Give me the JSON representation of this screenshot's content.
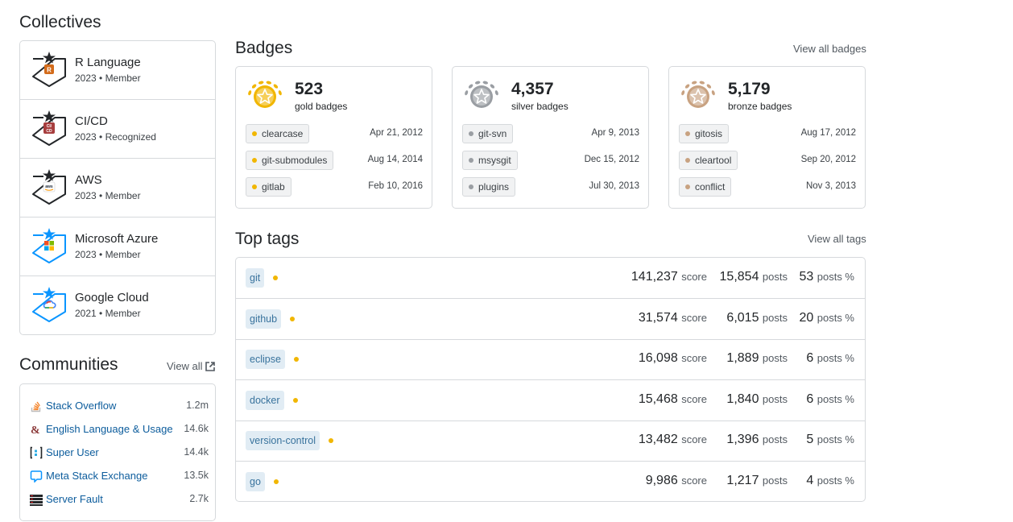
{
  "collectives": {
    "title": "Collectives",
    "items": [
      {
        "name": "R Language",
        "meta": "2023 • Member",
        "icon": "r-language-icon",
        "color": "#d36b1a"
      },
      {
        "name": "CI/CD",
        "meta": "2023 • Recognized",
        "icon": "cicd-icon",
        "color": "#a73e3e"
      },
      {
        "name": "AWS",
        "meta": "2023 • Member",
        "icon": "aws-icon",
        "color": "#232f3e"
      },
      {
        "name": "Microsoft Azure",
        "meta": "2023 • Member",
        "icon": "microsoft-azure-icon",
        "color": "#0078d4"
      },
      {
        "name": "Google Cloud",
        "meta": "2021 • Member",
        "icon": "google-cloud-icon",
        "color": "#4285f4"
      }
    ]
  },
  "communities": {
    "title": "Communities",
    "view_all": "View all",
    "items": [
      {
        "name": "Stack Overflow",
        "count": "1.2m",
        "icon": "stack-overflow-icon"
      },
      {
        "name": "English Language & Usage",
        "count": "14.6k",
        "icon": "english-language-usage-icon"
      },
      {
        "name": "Super User",
        "count": "14.4k",
        "icon": "super-user-icon"
      },
      {
        "name": "Meta Stack Exchange",
        "count": "13.5k",
        "icon": "meta-stack-exchange-icon"
      },
      {
        "name": "Server Fault",
        "count": "2.7k",
        "icon": "server-fault-icon"
      }
    ]
  },
  "badges": {
    "title": "Badges",
    "view_all": "View all badges",
    "cards": [
      {
        "count": "523",
        "label": "gold badges",
        "color": "#f1b600",
        "items": [
          {
            "tag": "clearcase",
            "date": "Apr 21, 2012"
          },
          {
            "tag": "git-submodules",
            "date": "Aug 14, 2014"
          },
          {
            "tag": "gitlab",
            "date": "Feb 10, 2016"
          }
        ]
      },
      {
        "count": "4,357",
        "label": "silver badges",
        "color": "#9a9ea3",
        "items": [
          {
            "tag": "git-svn",
            "date": "Apr 9, 2013"
          },
          {
            "tag": "msysgit",
            "date": "Dec 15, 2012"
          },
          {
            "tag": "plugins",
            "date": "Jul 30, 2013"
          }
        ]
      },
      {
        "count": "5,179",
        "label": "bronze badges",
        "color": "#c8a281",
        "items": [
          {
            "tag": "gitosis",
            "date": "Aug 17, 2012"
          },
          {
            "tag": "cleartool",
            "date": "Sep 20, 2012"
          },
          {
            "tag": "conflict",
            "date": "Nov 3, 2013"
          }
        ]
      }
    ]
  },
  "top_tags": {
    "title": "Top tags",
    "view_all": "View all tags",
    "score_unit": "score",
    "posts_unit": "posts",
    "pct_unit": "posts %",
    "rows": [
      {
        "tag": "git",
        "score": "141,237",
        "posts": "15,854",
        "pct": "53"
      },
      {
        "tag": "github",
        "score": "31,574",
        "posts": "6,015",
        "pct": "20"
      },
      {
        "tag": "eclipse",
        "score": "16,098",
        "posts": "1,889",
        "pct": "6"
      },
      {
        "tag": "docker",
        "score": "15,468",
        "posts": "1,840",
        "pct": "6"
      },
      {
        "tag": "version-control",
        "score": "13,482",
        "posts": "1,396",
        "pct": "5"
      },
      {
        "tag": "go",
        "score": "9,986",
        "posts": "1,217",
        "pct": "4"
      }
    ]
  }
}
